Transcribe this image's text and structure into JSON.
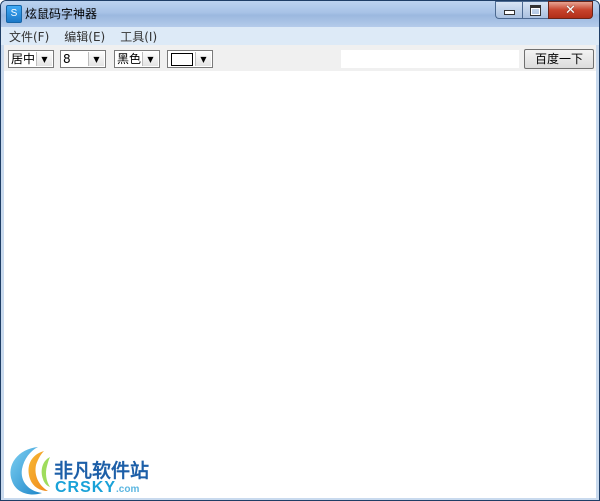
{
  "window": {
    "title": "炫鼠码字神器",
    "app_icon_glyph": "S",
    "caption": {
      "minimize": "minimize-icon",
      "maximize": "maximize-icon",
      "close": "close-icon"
    }
  },
  "menu": {
    "items": [
      {
        "label": "文件(F)"
      },
      {
        "label": "编辑(E)"
      },
      {
        "label": "工具(I)"
      }
    ]
  },
  "toolbar": {
    "align_value": "居中",
    "size_value": "8",
    "color_value": "黑色",
    "bg_swatch_color": "#ffffff",
    "search_value": "",
    "baidu_label": "百度一下"
  },
  "watermark": {
    "text_cn": "非凡软件站",
    "text_en": "CRSKY",
    "text_en_suffix": ".com"
  },
  "colors": {
    "titlebar": "#a7c2e6",
    "close_button": "#c7432c",
    "menubar": "#ddeaf7",
    "toolbar": "#f0f0f0",
    "watermark_blue": "#1d5fa8"
  }
}
